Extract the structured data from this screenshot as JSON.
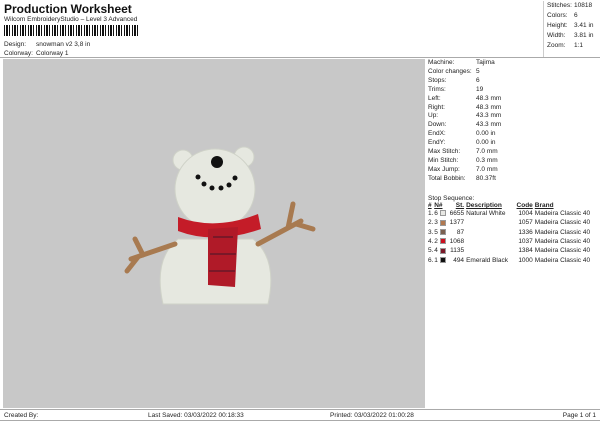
{
  "header": {
    "title": "Production Worksheet",
    "subtitle": "Wilcom EmbroideryStudio – Level 3 Advanced",
    "design_label": "Design:",
    "design": "snowman v2 3,8 in",
    "colorway_label": "Colorway:",
    "colorway": "Colorway 1"
  },
  "stats": [
    {
      "k": "Stitches:",
      "v": "10818"
    },
    {
      "k": "Colors:",
      "v": "6"
    },
    {
      "k": "Height:",
      "v": "3.41 in"
    },
    {
      "k": "Width:",
      "v": "3.81 in"
    },
    {
      "k": "Zoom:",
      "v": "1:1"
    }
  ],
  "info": [
    {
      "k": "Machine:",
      "v": "Tajima"
    },
    {
      "k": "Color changes:",
      "v": "5"
    },
    {
      "k": "Stops:",
      "v": "6"
    },
    {
      "k": "Trims:",
      "v": "19"
    },
    {
      "k": "Left:",
      "v": "48.3 mm"
    },
    {
      "k": "Right:",
      "v": "48.3 mm"
    },
    {
      "k": "Up:",
      "v": "43.3 mm"
    },
    {
      "k": "Down:",
      "v": "43.3 mm"
    },
    {
      "k": "EndX:",
      "v": "0.00 in"
    },
    {
      "k": "EndY:",
      "v": "0.00 in"
    },
    {
      "k": "Max Stitch:",
      "v": "7.0 mm"
    },
    {
      "k": "Min Stitch:",
      "v": "0.3 mm"
    },
    {
      "k": "Max Jump:",
      "v": "7.0 mm"
    },
    {
      "k": "Total Bobbin:",
      "v": "80.37ft"
    }
  ],
  "stop_sequence_label": "Stop Sequence:",
  "columns": [
    "#",
    "N#",
    "St.",
    "Description",
    "Code",
    "Brand"
  ],
  "stops": [
    {
      "i": "1.",
      "n": "6",
      "color": "#e8e8e4",
      "st": "6655",
      "desc": "Natural White",
      "code": "1004",
      "brand": "Madeira Classic 40"
    },
    {
      "i": "2.",
      "n": "3",
      "color": "#b07850",
      "st": "1377",
      "desc": "",
      "code": "1057",
      "brand": "Madeira Classic 40"
    },
    {
      "i": "3.",
      "n": "5",
      "color": "#7a6050",
      "st": "87",
      "desc": "",
      "code": "1336",
      "brand": "Madeira Classic 40"
    },
    {
      "i": "4.",
      "n": "2",
      "color": "#cc1020",
      "st": "1068",
      "desc": "",
      "code": "1037",
      "brand": "Madeira Classic 40"
    },
    {
      "i": "5.",
      "n": "4",
      "color": "#7a1828",
      "st": "1135",
      "desc": "",
      "code": "1384",
      "brand": "Madeira Classic 40"
    },
    {
      "i": "6.",
      "n": "1",
      "color": "#111111",
      "st": "494",
      "desc": "Emerald Black",
      "code": "1000",
      "brand": "Madeira Classic 40"
    }
  ],
  "footer": {
    "created": "Created By:",
    "saved": "Last Saved: 03/03/2022 00:18:33",
    "printed": "Printed: 03/03/2022 01:00:28",
    "page": "Page 1 of 1"
  }
}
